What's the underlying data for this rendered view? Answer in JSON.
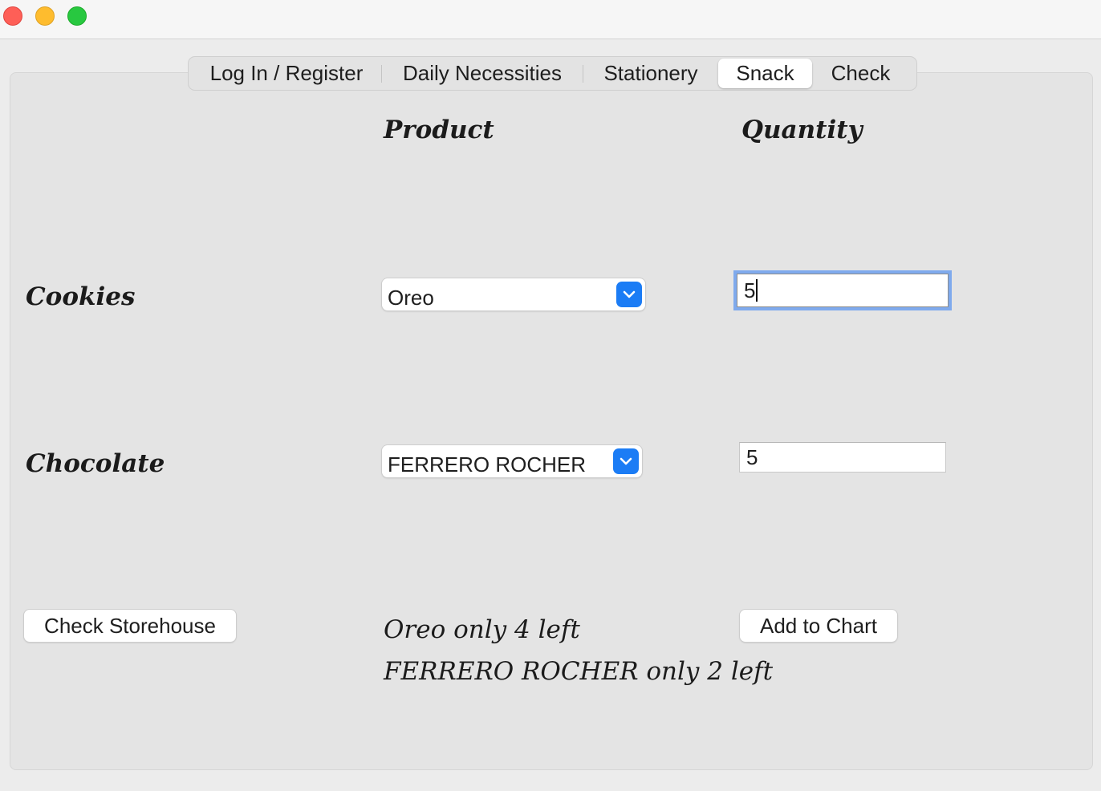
{
  "window": {
    "traffic_lights": [
      "close",
      "minimize",
      "zoom"
    ]
  },
  "tabs": [
    {
      "label": "Log In / Register",
      "active": false
    },
    {
      "label": "Daily Necessities",
      "active": false
    },
    {
      "label": "Stationery",
      "active": false
    },
    {
      "label": "Snack",
      "active": true
    },
    {
      "label": "Check",
      "active": false
    }
  ],
  "headers": {
    "product": "Product",
    "quantity": "Quantity"
  },
  "rows": [
    {
      "label": "Cookies",
      "product_selected": "Oreo",
      "quantity": "5"
    },
    {
      "label": "Chocolate",
      "product_selected": "FERRERO ROCHER",
      "quantity": "5"
    }
  ],
  "buttons": {
    "check_storehouse": "Check Storehouse",
    "add_to_chart": "Add to Chart"
  },
  "stock_messages": [
    "Oreo only 4 left",
    "FERRERO ROCHER only 2 left"
  ],
  "colors": {
    "accent": "#1b7cf5",
    "focus_ring": "#7faaed"
  },
  "icons": {
    "select_arrow": "chevron-down-icon"
  }
}
